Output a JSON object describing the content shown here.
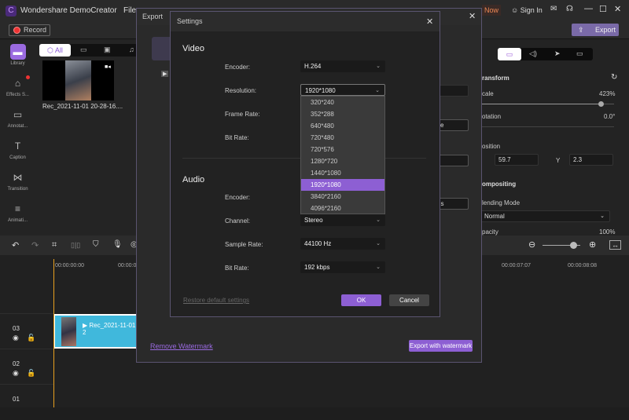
{
  "app": {
    "title": "Wondershare DemoCreator",
    "menu_file": "File",
    "buy_now": "Now",
    "sign_in": "Sign In",
    "record": "Record",
    "export": "Export"
  },
  "sidebar": {
    "items": [
      {
        "label": "Library",
        "icon": "folder-icon"
      },
      {
        "label": "Effects S...",
        "icon": "store-icon"
      },
      {
        "label": "Annotat...",
        "icon": "annotation-icon"
      },
      {
        "label": "Caption",
        "icon": "caption-icon"
      },
      {
        "label": "Transition",
        "icon": "transition-icon"
      },
      {
        "label": "Animati...",
        "icon": "animation-icon"
      }
    ]
  },
  "media": {
    "tab_all": "All",
    "clip_name": "Rec_2021-11-01 20-28-16...."
  },
  "properties": {
    "transform": "ransform",
    "scale_label": "cale",
    "scale_value": "423%",
    "scale_level": 0.9,
    "rotation_label": "otation",
    "rotation_value": "0.0°",
    "position_label": "osition",
    "x": "59.7",
    "y_label": "Y",
    "y": "2.3",
    "compositing": "ompositing",
    "blending_label": "lending Mode",
    "blending_value": "Normal",
    "opacity_label": "pacity",
    "opacity_value": "100%"
  },
  "timeline": {
    "time0": "00:00:00:00",
    "time1": "00:00:0",
    "time7": "00:00:07:07",
    "time8": "00:00:08:08",
    "tracks": [
      "03",
      "02",
      "01"
    ],
    "clip": "Rec_2021-11-01 2"
  },
  "export_dialog": {
    "title": "Export",
    "remove_watermark": "Remove Watermark",
    "export_with_watermark": "Export with watermark",
    "partial_fields": [
      "",
      "se",
      "d",
      "gs"
    ]
  },
  "settings": {
    "title": "Settings",
    "video_heading": "Video",
    "audio_heading": "Audio",
    "encoder_label": "Encoder:",
    "encoder": "H.264",
    "resolution_label": "Resolution:",
    "resolution": "1920*1080",
    "frame_rate_label": "Frame Rate:",
    "bit_rate_label": "Bit Rate:",
    "resolution_options": [
      "320*240",
      "352*288",
      "640*480",
      "720*480",
      "720*576",
      "1280*720",
      "1440*1080",
      "1920*1080",
      "3840*2160",
      "4096*2160"
    ],
    "audio_encoder_label": "Encoder:",
    "channel_label": "Channel:",
    "channel": "Stereo",
    "sample_rate_label": "Sample Rate:",
    "sample_rate": "44100 Hz",
    "audio_bit_rate_label": "Bit Rate:",
    "audio_bit_rate": "192 kbps",
    "restore": "Restore default settings",
    "ok": "OK",
    "cancel": "Cancel"
  },
  "colors": {
    "accent": "#8d5fd3",
    "clip": "#40b8dc",
    "playhead": "#e8a020"
  }
}
